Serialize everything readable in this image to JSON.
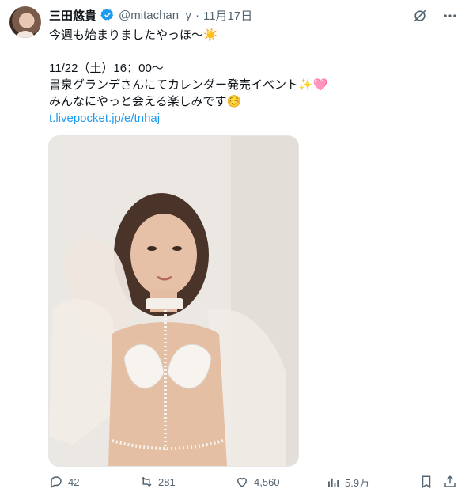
{
  "tweet": {
    "author_name": "三田悠貴",
    "handle": "@mitachan_y",
    "separator": "·",
    "date": "11月17日",
    "lines": [
      "今週も始まりましたやっほ〜☀️",
      "",
      "11/22（土）16：00〜",
      "書泉グランデさんにてカレンダー発売イベント✨🩷",
      "みんなにやっと会える楽しみです☺️"
    ],
    "link": "t.livepocket.jp/e/tnhaj"
  },
  "actions": {
    "replies": "42",
    "reposts": "281",
    "likes": "4,560",
    "views": "5.9万"
  },
  "colors": {
    "text": "#0f1419",
    "secondary": "#536471",
    "link": "#1d9bf0",
    "verified": "#1d9bf0"
  },
  "icons": [
    "verified-badge-icon",
    "grok-icon",
    "more-icon",
    "reply-icon",
    "repost-icon",
    "like-icon",
    "views-icon",
    "bookmark-icon",
    "share-icon"
  ]
}
